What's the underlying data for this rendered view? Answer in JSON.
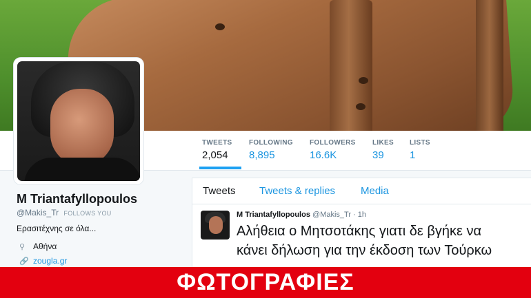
{
  "profile": {
    "name": "M Triantafyllopoulos",
    "handle": "@Makis_Tr",
    "follows_you": "FOLLOWS YOU",
    "bio": "Ερασιτέχνης σε όλα...",
    "location": "Αθήνα",
    "website": "zougla.gr",
    "location_icon": "map-pin-icon",
    "link_icon": "link-icon"
  },
  "stats": [
    {
      "label": "TWEETS",
      "value": "2,054"
    },
    {
      "label": "FOLLOWING",
      "value": "8,895"
    },
    {
      "label": "FOLLOWERS",
      "value": "16.6K"
    },
    {
      "label": "LIKES",
      "value": "39"
    },
    {
      "label": "LISTS",
      "value": "1"
    }
  ],
  "tabs": [
    {
      "label": "Tweets"
    },
    {
      "label": "Tweets & replies"
    },
    {
      "label": "Media"
    }
  ],
  "tweet": {
    "name": "M Triantafyllopoulos",
    "handle": "@Makis_Tr",
    "separator": "·",
    "time": "1h",
    "line1": "Αλήθεια ο  Μητσοτάκης γιατι δε βγήκε να",
    "line2": "κάνει δήλωση για την έκδοση των Τούρκω"
  },
  "overlay": {
    "label": "ΦΩΤΟΓΡΑΦΙΕΣ"
  },
  "colors": {
    "accent": "#1da1f2",
    "link": "#1b95e0",
    "overlay_red": "#e3000f"
  }
}
